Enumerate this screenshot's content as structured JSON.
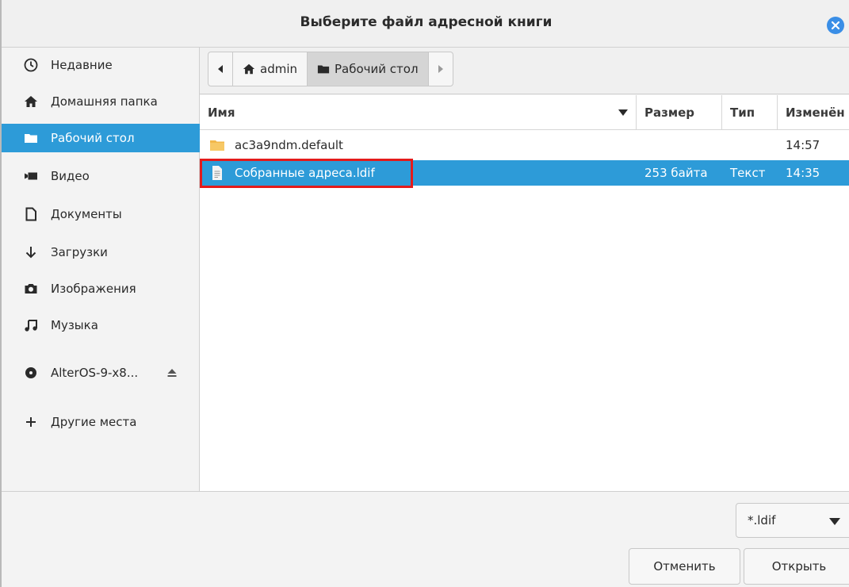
{
  "window": {
    "title": "Выберите файл адресной книги"
  },
  "sidebar": {
    "items": [
      {
        "label": "Недавние",
        "icon": "clock-icon"
      },
      {
        "label": "Домашняя папка",
        "icon": "home-icon"
      },
      {
        "label": "Рабочий стол",
        "icon": "folder-icon",
        "active": true
      },
      {
        "label": "Видео",
        "icon": "video-icon"
      },
      {
        "label": "Документы",
        "icon": "document-icon"
      },
      {
        "label": "Загрузки",
        "icon": "download-icon"
      },
      {
        "label": "Изображения",
        "icon": "camera-icon"
      },
      {
        "label": "Музыка",
        "icon": "music-icon"
      },
      {
        "label": "AlterOS-9-x8...",
        "icon": "disc-icon",
        "ejectable": true
      },
      {
        "label": "Другие места",
        "icon": "plus-icon"
      }
    ]
  },
  "pathbar": {
    "segments": [
      {
        "label": "admin",
        "icon": "home-icon"
      },
      {
        "label": "Рабочий стол",
        "icon": "folder-icon",
        "current": true
      }
    ]
  },
  "filelist": {
    "columns": {
      "name": "Имя",
      "size": "Размер",
      "type": "Тип",
      "modified": "Изменён"
    },
    "rows": [
      {
        "name": "ac3a9ndm.default",
        "size": "",
        "type": "",
        "modified": "14:57",
        "icon": "folder-icon",
        "selected": false
      },
      {
        "name": "Собранные адреса.ldif",
        "size": "253 байта",
        "type": "Текст",
        "modified": "14:35",
        "icon": "text-file-icon",
        "selected": true
      }
    ]
  },
  "footer": {
    "filter": "*.ldif",
    "cancel_label": "Отменить",
    "open_label": "Открыть"
  },
  "colors": {
    "accent": "#2d9bd8",
    "highlight": "#e41b1b",
    "folder": "#f2b84b"
  }
}
